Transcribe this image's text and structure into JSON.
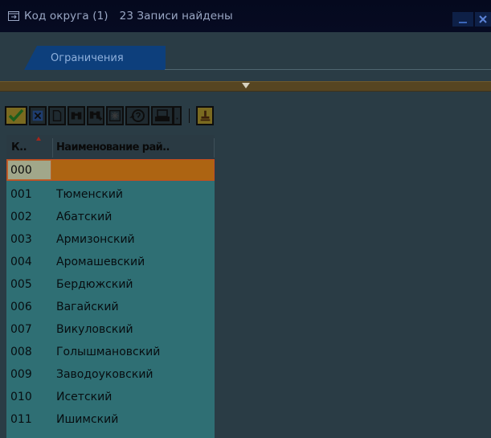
{
  "window": {
    "title_part1": "Код округа (1)",
    "title_part2": "23 Записи найдены"
  },
  "tabs": [
    {
      "label": "Ограничения"
    }
  ],
  "toolbar": {
    "buttons": [
      "check-icon",
      "cancel-icon",
      "new-document-icon",
      "find-icon",
      "find-next-icon",
      "multiple-selection-icon",
      "help-icon",
      "print-icon",
      "print-dropdown-icon",
      "adhoc-help-icon"
    ]
  },
  "table": {
    "headers": [
      "К..",
      "Наименование рай.."
    ],
    "rows": [
      {
        "code": "000",
        "name": ""
      },
      {
        "code": "001",
        "name": "Тюменский"
      },
      {
        "code": "002",
        "name": "Абатский"
      },
      {
        "code": "003",
        "name": "Армизонский"
      },
      {
        "code": "004",
        "name": "Аромашевский"
      },
      {
        "code": "005",
        "name": "Бердюжский"
      },
      {
        "code": "006",
        "name": "Вагайский"
      },
      {
        "code": "007",
        "name": "Викуловский"
      },
      {
        "code": "008",
        "name": "Голышмановский"
      },
      {
        "code": "009",
        "name": "Заводоуковский"
      },
      {
        "code": "010",
        "name": "Исетский"
      },
      {
        "code": "011",
        "name": "Ишимский"
      }
    ]
  },
  "colors": {
    "title_bar": "#05091e",
    "tab": "#0d3f7c",
    "list_bg": "#2f6f74",
    "selected_row": "#ad6412"
  }
}
